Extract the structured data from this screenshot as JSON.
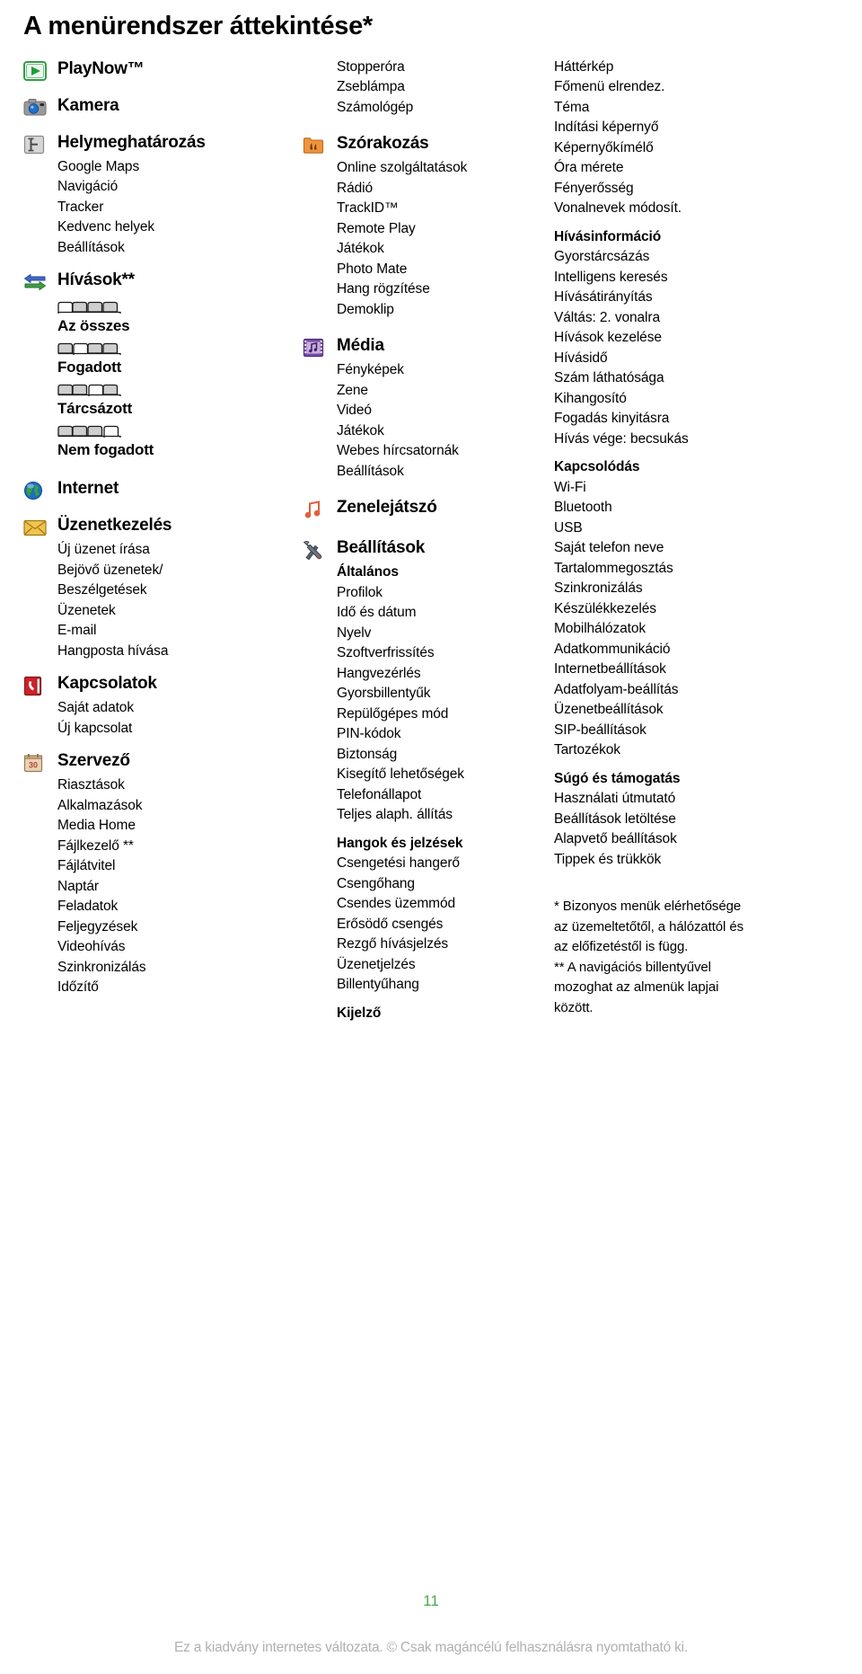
{
  "title": "A menürendszer áttekintése*",
  "columns": [
    {
      "id": "column-left",
      "groups": [
        {
          "icon": "playnow-icon",
          "label": "PlayNow™",
          "items": []
        },
        {
          "icon": "camera-icon",
          "label": "Kamera",
          "items": []
        },
        {
          "icon": "location-icon",
          "label": "Helymeghatározás",
          "items": [
            "Google Maps",
            "Navigáció",
            "Tracker",
            "Kedvenc helyek",
            "Beállítások"
          ]
        },
        {
          "icon": "calls-icon",
          "label": "Hívások**",
          "items": [],
          "calllog": [
            {
              "tab": 1,
              "label": "Az összes"
            },
            {
              "tab": 2,
              "label": "Fogadott"
            },
            {
              "tab": 3,
              "label": "Tárcsázott"
            },
            {
              "tab": 4,
              "label": "Nem fogadott"
            }
          ]
        },
        {
          "icon": "internet-icon",
          "label": "Internet",
          "items": []
        },
        {
          "icon": "messaging-icon",
          "label": "Üzenetkezelés",
          "items": [
            "Új üzenet írása",
            "Bejövő üzenetek/",
            "Beszélgetések",
            "Üzenetek",
            "E-mail",
            "Hangposta hívása"
          ]
        },
        {
          "icon": "contacts-icon",
          "label": "Kapcsolatok",
          "items": [
            "Saját adatok",
            "Új kapcsolat"
          ]
        },
        {
          "icon": "organizer-icon",
          "label": "Szervező",
          "items": [
            "Riasztások",
            "Alkalmazások",
            "Media Home",
            "Fájlkezelő **",
            "Fájlátvitel",
            "Naptár",
            "Feladatok",
            "Feljegyzések",
            "Videohívás",
            "Szinkronizálás",
            "Időzítő"
          ]
        }
      ]
    },
    {
      "id": "column-middle",
      "lead_items": [
        "Stopperóra",
        "Zseblámpa",
        "Számológép"
      ],
      "groups": [
        {
          "icon": "entertainment-icon",
          "label": "Szórakozás",
          "items": [
            "Online szolgáltatások",
            "Rádió",
            "TrackID™",
            "Remote Play",
            "Játékok",
            "Photo Mate",
            "Hang rögzítése",
            "Demoklip"
          ]
        },
        {
          "icon": "media-icon",
          "label": "Média",
          "items": [
            "Fényképek",
            "Zene",
            "Videó",
            "Játékok",
            "Webes hírcsatornák",
            "Beállítások"
          ]
        },
        {
          "icon": "musicplayer-icon",
          "label": "Zenelejátszó",
          "items": []
        },
        {
          "icon": "settings-icon",
          "label": "Beállítások",
          "sections": [
            {
              "heading": "Általános",
              "items": [
                "Profilok",
                "Idő és dátum",
                "Nyelv",
                "Szoftverfrissítés",
                "Hangvezérlés",
                "Gyorsbillentyűk",
                "Repülőgépes mód",
                "PIN-kódok",
                "Biztonság",
                "Kisegítő lehetőségek",
                "Telefonállapot",
                "Teljes alaph. állítás"
              ]
            },
            {
              "heading": "Hangok és jelzések",
              "items": [
                "Csengetési hangerő",
                "Csengőhang",
                "Csendes üzemmód",
                "Erősödő csengés",
                "Rezgő hívásjelzés",
                "Üzenetjelzés",
                "Billentyűhang"
              ]
            },
            {
              "heading": "Kijelző",
              "items": []
            }
          ]
        }
      ]
    },
    {
      "id": "column-right",
      "sections": [
        {
          "heading": "",
          "items": [
            "Háttérkép",
            "Főmenü elrendez.",
            "Téma",
            "Indítási képernyő",
            "Képernyőkímélő",
            "Óra mérete",
            "Fényerősség",
            "Vonalnevek módosít."
          ]
        },
        {
          "heading": "Hívásinformáció",
          "items": [
            "Gyorstárcsázás",
            "Intelligens keresés",
            "Hívásátirányítás",
            "Váltás: 2. vonalra",
            "Hívások kezelése",
            "Hívásidő",
            "Szám láthatósága",
            "Kihangosító",
            "Fogadás kinyitásra",
            "Hívás vége: becsukás"
          ]
        },
        {
          "heading": "Kapcsolódás",
          "items": [
            "Wi-Fi",
            "Bluetooth",
            "USB",
            "Saját telefon neve",
            "Tartalommegosztás",
            "Szinkronizálás",
            "Készülékkezelés",
            "Mobilhálózatok",
            "Adatkommunikáció",
            "Internetbeállítások",
            "Adatfolyam-beállítás",
            "Üzenetbeállítások",
            "SIP-beállítások",
            "Tartozékok"
          ]
        },
        {
          "heading": "Súgó és támogatás",
          "items": [
            "Használati útmutató",
            "Beállítások letöltése",
            "Alapvető beállítások",
            "Tippek és trükkök"
          ]
        }
      ],
      "footnotes": [
        "* Bizonyos menük elérhetősége",
        "az üzemeltetőtől, a hálózattól és",
        "az előfizetéstől is függ.",
        "** A navigációs billentyűvel",
        "mozoghat az almenük lapjai",
        "között."
      ]
    }
  ],
  "page_number": "11",
  "legal": "Ez a kiadvány internetes változata. © Csak magáncélú felhasználásra nyomtatható ki.",
  "colors": {
    "page_number": "#4aa94a",
    "legal": "#b0b0b0"
  }
}
